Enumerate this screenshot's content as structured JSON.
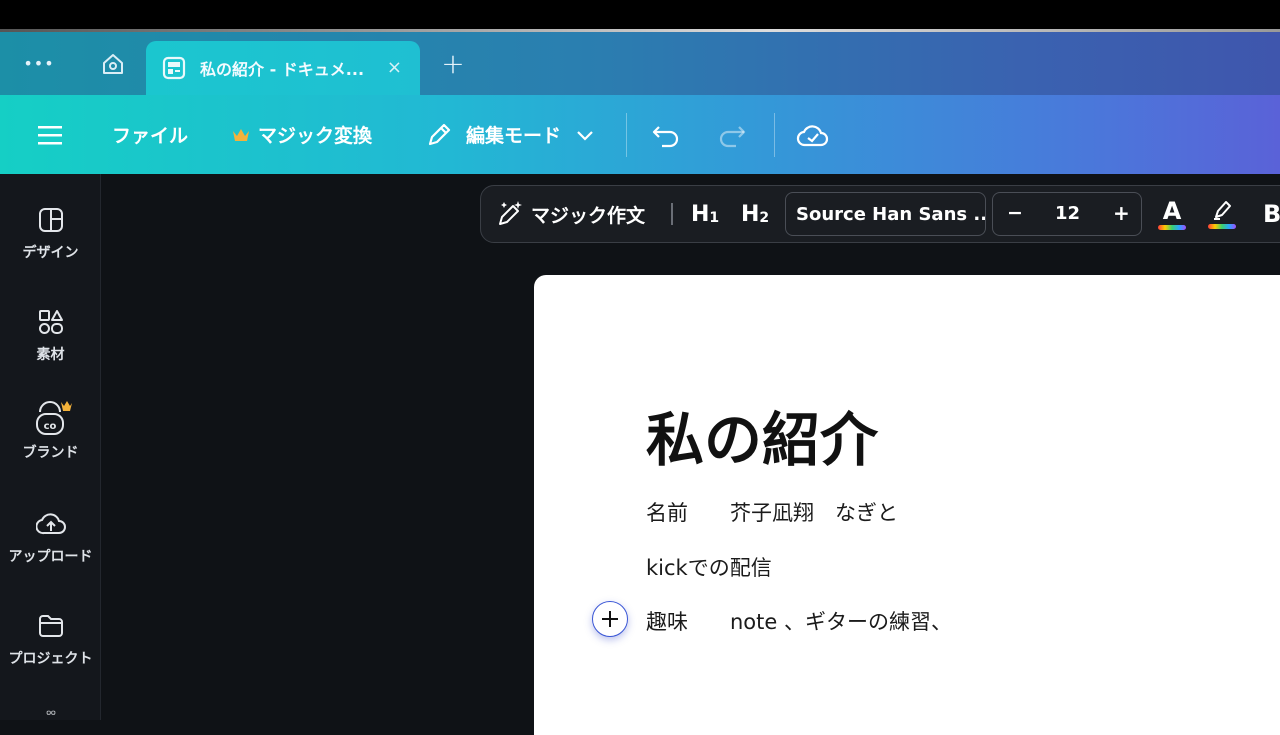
{
  "tabbar": {
    "more_label": "•••",
    "active_tab_title": "私の紹介 - ドキュメ...",
    "close_label": "×",
    "new_tab_label": "+"
  },
  "toolbar": {
    "file_label": "ファイル",
    "magic_switch_label": "マジック変換",
    "edit_mode_label": "編集モード"
  },
  "sidebar": {
    "items": [
      {
        "label": "デザイン",
        "icon": "design-icon"
      },
      {
        "label": "素材",
        "icon": "elements-icon"
      },
      {
        "label": "ブランド",
        "icon": "brand-icon"
      },
      {
        "label": "アップロード",
        "icon": "upload-icon"
      },
      {
        "label": "プロジェクト",
        "icon": "folder-icon"
      }
    ]
  },
  "format_bar": {
    "magic_write_label": "マジック作文",
    "h1_label": "H",
    "h1_sub": "1",
    "h2_label": "H",
    "h2_sub": "2",
    "font_name": "Source Han Sans ...",
    "minus_label": "−",
    "font_size": "12",
    "plus_label": "+",
    "text_color_label": "A",
    "bold_label": "B"
  },
  "document": {
    "title": "私の紹介",
    "lines": [
      "名前　　芥子凪翔　なぎと",
      "kickでの配信",
      "趣味　　note 、ギターの練習、"
    ]
  },
  "colors": {
    "accent": "#3b57d6",
    "crown": "#f4b23a"
  }
}
